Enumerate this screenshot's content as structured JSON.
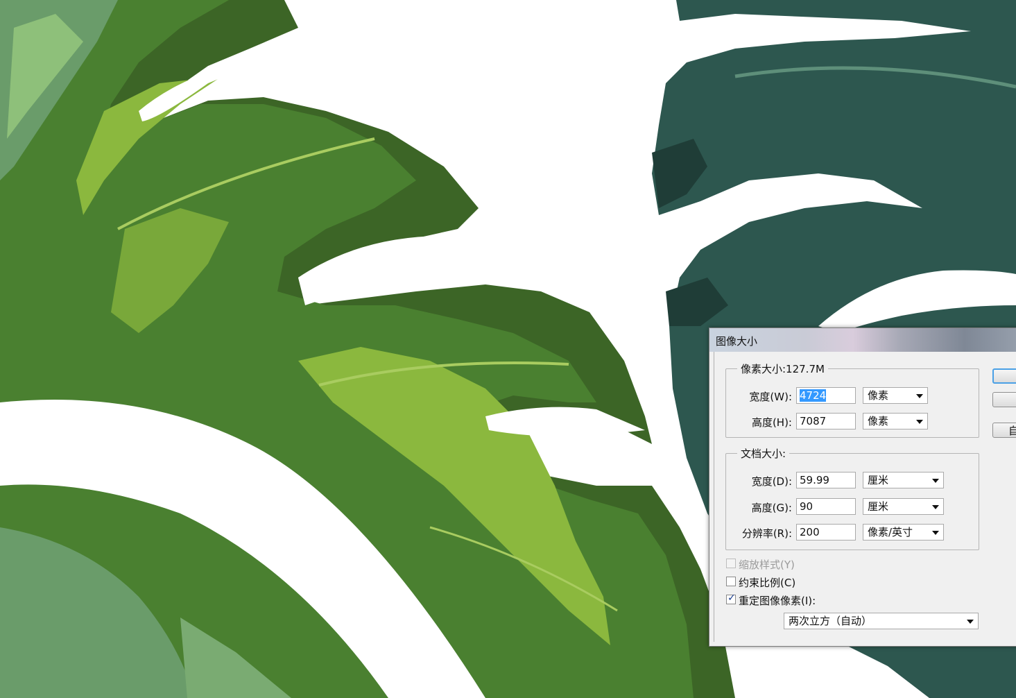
{
  "colors": {
    "leaf_dark": "#3c6526",
    "leaf_mid": "#4a8030",
    "leaf_light": "#8bb83e",
    "leaf_sage": "#6a9c6a",
    "monstera_dark": "#2d574f",
    "monstera_darker": "#1f3d37",
    "selection": "#3399ff"
  },
  "dialog": {
    "title": "图像大小",
    "pixel_dimensions": {
      "title": "像素大小:127.7M",
      "width_label": "宽度(W):",
      "width_value": "4724",
      "width_unit": "像素",
      "height_label": "高度(H):",
      "height_value": "7087",
      "height_unit": "像素"
    },
    "document_size": {
      "title": "文档大小:",
      "width_label": "宽度(D):",
      "width_value": "59.99",
      "width_unit": "厘米",
      "height_label": "高度(G):",
      "height_value": "90",
      "height_unit": "厘米",
      "resolution_label": "分辨率(R):",
      "resolution_value": "200",
      "resolution_unit": "像素/英寸"
    },
    "options": {
      "scale_styles": "缩放样式(Y)",
      "scale_styles_checked": false,
      "constrain": "约束比例(C)",
      "constrain_checked": false,
      "resample": "重定图像像素(I):",
      "resample_checked": true,
      "resample_method": "两次立方（自动）"
    },
    "buttons": {
      "ok": "",
      "cancel": "",
      "auto": "自"
    }
  }
}
